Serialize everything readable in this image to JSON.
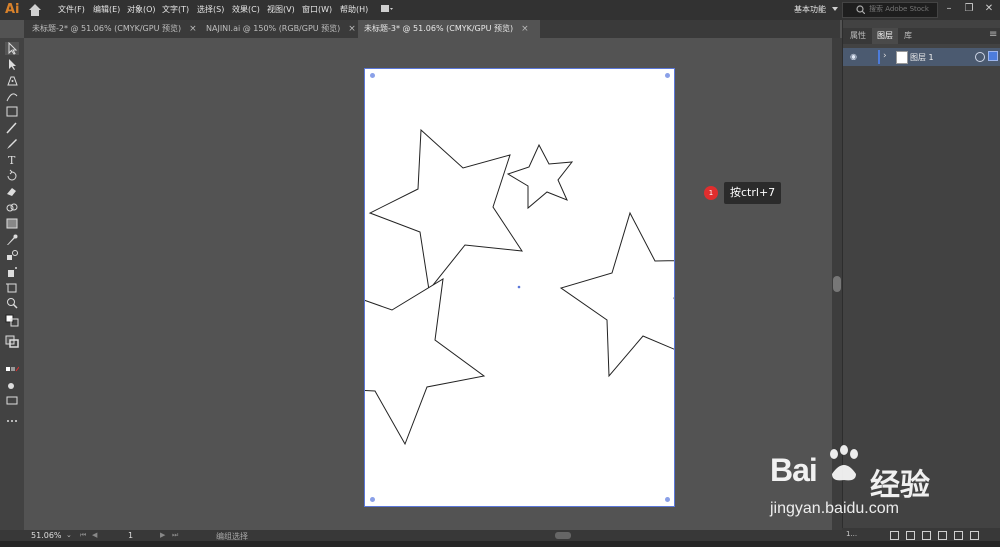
{
  "app": {
    "logo": "Ai"
  },
  "menu": [
    "文件(F)",
    "编辑(E)",
    "对象(O)",
    "文字(T)",
    "选择(S)",
    "效果(C)",
    "视图(V)",
    "窗口(W)",
    "帮助(H)"
  ],
  "header": {
    "workspace": "基本功能",
    "stock_placeholder": "搜索 Adobe Stock"
  },
  "tabs": [
    {
      "label": "未标题-2* @ 51.06% (CMYK/GPU 预览)",
      "active": false
    },
    {
      "label": "NAJINI.ai @ 150% (RGB/GPU 预览)",
      "active": false
    },
    {
      "label": "未标题-3* @ 51.06% (CMYK/GPU 预览)",
      "active": true
    }
  ],
  "tab_close": "×",
  "panel": {
    "tabs": [
      "属性",
      "图层",
      "库"
    ],
    "active_tab": "图层",
    "layer_name": "图层 1",
    "layer_count": "1..."
  },
  "tooltip": {
    "badge": "1",
    "text": "按ctrl+7"
  },
  "status": {
    "zoom": "51.06%",
    "page": "1",
    "status_text": "编组选择"
  },
  "watermark": {
    "brand": "Bai",
    "brand2": "经验",
    "url": "jingyan.baidu.com"
  },
  "icons": [
    "home-icon",
    "selection-tool-icon",
    "direct-selection-icon",
    "pen-tool-icon",
    "curvature-tool-icon",
    "rectangle-tool-icon",
    "paintbrush-icon",
    "pencil-icon",
    "type-tool-icon",
    "rotate-tool-icon",
    "eraser-icon",
    "shape-builder-icon",
    "gradient-icon",
    "eyedropper-icon",
    "blend-tool-icon",
    "symbol-sprayer-icon",
    "artboard-tool-icon",
    "zoom-tool-icon",
    "eye-icon",
    "minimize-icon",
    "maximize-icon",
    "close-icon"
  ],
  "colors": {
    "accent": "#4c7cdc",
    "logo": "#d9822b",
    "badge": "#e02e2e"
  }
}
